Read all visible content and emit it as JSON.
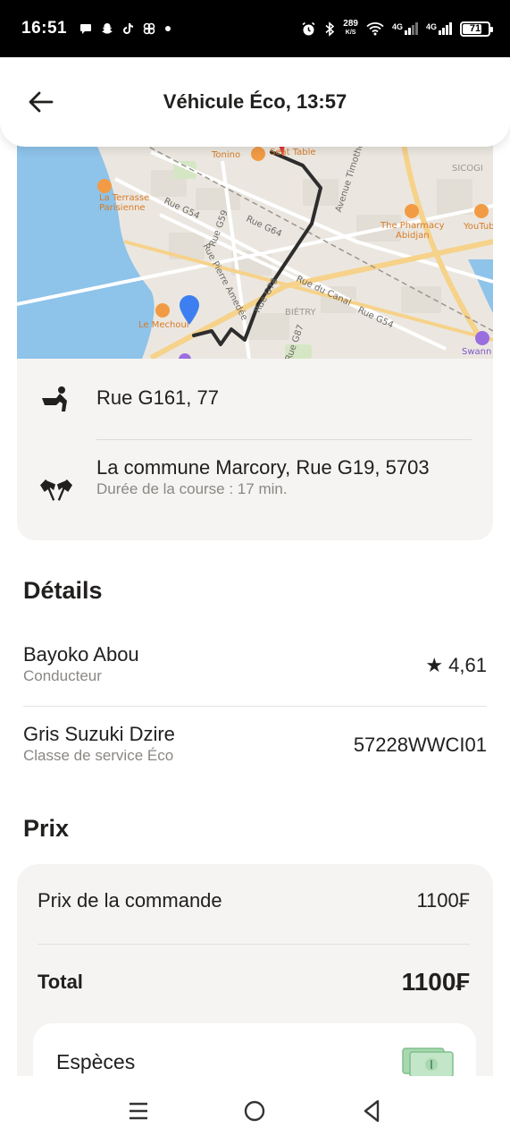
{
  "status_bar": {
    "time": "16:51",
    "net_speed": "289",
    "net_unit": "K/S",
    "sig1_label": "4G",
    "sig2_label": "4G",
    "battery": "71"
  },
  "header": {
    "title": "Véhicule Éco, 13:57"
  },
  "map": {
    "labels": {
      "tonino": "Tonino",
      "seat_table": "Seat Table",
      "sicogi": "SICOGI",
      "terrasse": "La Terrasse",
      "parisienne": "Parisienne",
      "rue_g54_a": "Rue G54",
      "rue_g59": "Rue G59",
      "rue_g64": "Rue G64",
      "pharmacy": "The Pharmacy",
      "abidjan": "Abidjan",
      "youtub": "YouTub",
      "pierre": "Rue Pierre Amedée",
      "canal": "Rue du Canal",
      "bietry": "BIÉTRY",
      "rue_g54_b": "Rue G54",
      "rue_g87": "Rue G87",
      "mechoui": "Le Mechoui",
      "swann": "Swann",
      "timothee": "Avenue Timothée",
      "rue_g78": "Rue G78"
    }
  },
  "route": {
    "pickup": "Rue G161, 77",
    "destination": "La commune Marcory, Rue G19, 5703",
    "duration": "Durée de la course : 17 min."
  },
  "details": {
    "title": "Détails",
    "driver_name": "Bayoko Abou",
    "driver_role": "Conducteur",
    "rating": "★ 4,61",
    "car": "Gris Suzuki Dzire",
    "service_class": "Classe de service Éco",
    "plate": "57228WWCI01"
  },
  "price": {
    "title": "Prix",
    "order_label": "Prix de la commande",
    "order_value": "1100₣",
    "total_label": "Total",
    "total_value": "1100₣",
    "payment_method": "Espèces"
  }
}
